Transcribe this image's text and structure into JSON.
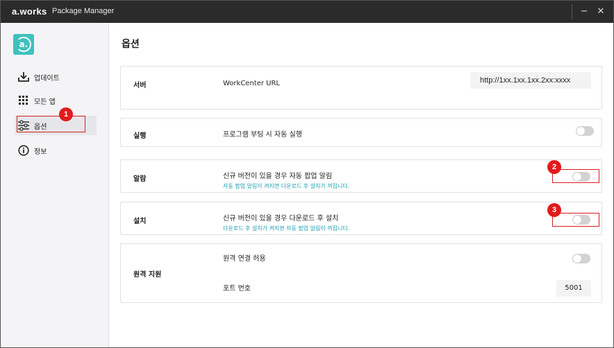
{
  "titlebar": {
    "brand": "a.works",
    "app_name": "Package Manager",
    "minimize_glyph": "−",
    "close_glyph": "✕"
  },
  "sidebar": {
    "logo_text": "a.",
    "items": [
      {
        "label": "업데이트",
        "icon": "download-icon"
      },
      {
        "label": "모든 앱",
        "icon": "grid-icon"
      },
      {
        "label": "옵션",
        "icon": "sliders-icon",
        "active": true
      },
      {
        "label": "정보",
        "icon": "info-icon"
      }
    ]
  },
  "main": {
    "title": "옵션",
    "server": {
      "title": "서버",
      "label": "WorkCenter URL",
      "url_value": "http://1xx.1xx.1xx.2xx:xxxx"
    },
    "run": {
      "title": "실행",
      "label": "프로그램 부팅 시 자동 실행"
    },
    "alarm": {
      "title": "알람",
      "label": "신규 버전이 있을 경우 자동 팝업 알림",
      "sub": "자동 팝업 알림이 켜지면 다운로드 후 설치가 꺼집니다."
    },
    "install": {
      "title": "설치",
      "label": "신규 버전이 있을 경우 다운로드 후 설치",
      "sub": "다운로드 후 설치가 켜지면 자동 팝업 알림이 꺼집니다."
    },
    "remote": {
      "title": "원격 지원",
      "allow_label": "원격 연결 허용",
      "port_label": "포트 번호",
      "port_value": "5001"
    }
  },
  "annotations": {
    "markers": [
      "1",
      "2",
      "3"
    ],
    "color": "#e21b1b"
  },
  "colors": {
    "accent": "#3fc1bd",
    "hint_text": "#1a9fb3",
    "titlebar": "#2b2b2b",
    "toggle_off": "#d3d3d3"
  }
}
